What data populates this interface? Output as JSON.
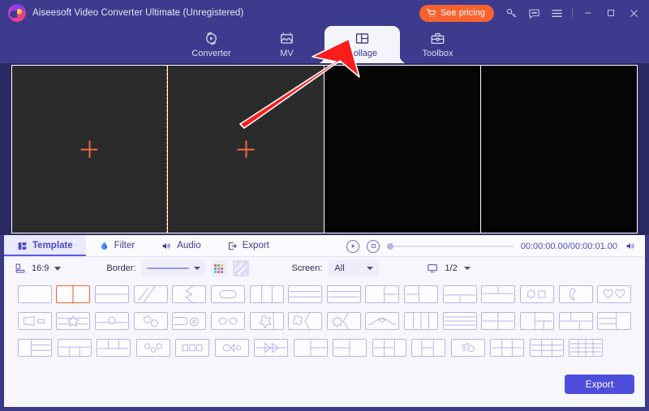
{
  "window": {
    "app_title": "Aiseesoft Video Converter Ultimate (Unregistered)",
    "logo_icon": "aiseesoft-logo-icon",
    "pricing_label": "See pricing",
    "pricing_icon": "shopping-cart-icon",
    "key_icon": "key-icon",
    "feedback_icon": "feedback-bubble-icon",
    "menu_icon": "hamburger-menu-icon",
    "minimize_icon": "minimize-icon",
    "maximize_icon": "maximize-icon",
    "close_icon": "close-icon",
    "accent_color": "#f8622f",
    "titlebar_color": "#3c3b8d"
  },
  "nav": {
    "tabs": [
      {
        "label": "Converter",
        "icon": "converter-icon",
        "active": false
      },
      {
        "label": "MV",
        "icon": "mv-picture-icon",
        "active": false
      },
      {
        "label": "Collage",
        "icon": "collage-layout-icon",
        "active": true
      },
      {
        "label": "Toolbox",
        "icon": "toolbox-icon",
        "active": false
      }
    ]
  },
  "preview": {
    "cells": [
      {
        "name": "collage-cell-1",
        "selected": true,
        "dark": false,
        "add_icon": "plus-add-media-icon"
      },
      {
        "name": "collage-cell-2",
        "selected": false,
        "dark": false,
        "add_icon": "plus-add-media-icon"
      },
      {
        "name": "collage-cell-3",
        "selected": false,
        "dark": true,
        "add_icon": ""
      },
      {
        "name": "collage-cell-4",
        "selected": false,
        "dark": true,
        "add_icon": ""
      }
    ]
  },
  "panel": {
    "tabs": [
      {
        "label": "Template",
        "icon": "template-layout-icon",
        "active": true
      },
      {
        "label": "Filter",
        "icon": "filter-droplet-icon",
        "active": false
      },
      {
        "label": "Audio",
        "icon": "audio-speaker-icon",
        "active": false
      },
      {
        "label": "Export",
        "icon": "export-arrow-icon",
        "active": false
      }
    ],
    "player": {
      "play_icon": "play-button-icon",
      "stop_icon": "stop-button-icon",
      "timecode": "00:00:00.00/00:00:01.00",
      "volume_icon": "volume-speaker-icon"
    },
    "settings": {
      "ratio_icon": "aspect-ratio-icon",
      "ratio_value": "16:9",
      "border_label": "Border:",
      "border_style_value": "solid-line",
      "border_color_icon": "color-palette-swatch-icon",
      "border_pattern_icon": "diagonal-stripes-swatch-icon",
      "screen_label": "Screen:",
      "screen_value": "All",
      "page_icon": "monitor-screen-icon",
      "page_value": "1/2"
    }
  },
  "templates": {
    "selected_index": 1,
    "rows": [
      [
        {
          "name": "template-single",
          "layout": "single"
        },
        {
          "name": "template-two-columns",
          "layout": "two-col"
        },
        {
          "name": "template-two-rows",
          "layout": "two-row"
        },
        {
          "name": "template-diagonal-split",
          "layout": "diagonal"
        },
        {
          "name": "template-arrow-cut",
          "layout": "arrow-cut"
        },
        {
          "name": "template-rounded-inset",
          "layout": "rounded-inset"
        },
        {
          "name": "template-three-columns",
          "layout": "three-col"
        },
        {
          "name": "template-three-rows",
          "layout": "three-row"
        },
        {
          "name": "template-three-rows-b",
          "layout": "three-row"
        },
        {
          "name": "template-left-big-right-split",
          "layout": "left-big-rsplit"
        },
        {
          "name": "template-left-split-right-big",
          "layout": "lsplit-right-big"
        },
        {
          "name": "template-top-wide-bottom-split",
          "layout": "top-wide-bsplit"
        },
        {
          "name": "template-top-split-bottom-wide",
          "layout": "tsplit-bottom-wide"
        },
        {
          "name": "template-hex-square",
          "layout": "hex-square"
        },
        {
          "name": "template-brush-shape",
          "layout": "brush"
        },
        {
          "name": "template-two-hearts",
          "layout": "hearts"
        }
      ],
      [
        {
          "name": "template-banner-small",
          "layout": "banner-small"
        },
        {
          "name": "template-star-band",
          "layout": "star-band"
        },
        {
          "name": "template-center-circle",
          "layout": "center-circle"
        },
        {
          "name": "template-two-circles",
          "layout": "two-circles"
        },
        {
          "name": "template-gear-shape",
          "layout": "gear"
        },
        {
          "name": "template-oval-pair",
          "layout": "oval-pair"
        },
        {
          "name": "template-star-cut",
          "layout": "star-cut"
        },
        {
          "name": "template-flower-cut",
          "layout": "flower-cut"
        },
        {
          "name": "template-burst-cut",
          "layout": "burst-cut"
        },
        {
          "name": "template-bow-shape",
          "layout": "bow"
        },
        {
          "name": "template-four-columns",
          "layout": "four-col"
        },
        {
          "name": "template-four-rows",
          "layout": "four-row"
        },
        {
          "name": "template-quad",
          "layout": "quad"
        },
        {
          "name": "template-left-big-three",
          "layout": "left-big-three"
        },
        {
          "name": "template-top-two-bottom-two",
          "layout": "t2b2"
        },
        {
          "name": "template-rows-right-big",
          "layout": "rows-right-big"
        }
      ],
      [
        {
          "name": "template-left-wide-right-rows",
          "layout": "lwide-rrows"
        },
        {
          "name": "template-top-wide-bottom-three",
          "layout": "twide-b3"
        },
        {
          "name": "template-top-three-bottom-wide",
          "layout": "t3-bwide"
        },
        {
          "name": "template-three-circles",
          "layout": "three-circles"
        },
        {
          "name": "template-three-squares",
          "layout": "three-squares"
        },
        {
          "name": "template-oval-arrow",
          "layout": "oval-arrow"
        },
        {
          "name": "template-double-arrow",
          "layout": "double-arrow"
        },
        {
          "name": "template-left-big-two-rows",
          "layout": "lbig-2rows"
        },
        {
          "name": "template-right-big-two-rows",
          "layout": "rbig-2rows"
        },
        {
          "name": "template-quad-right-wide",
          "layout": "quad-rwide"
        },
        {
          "name": "template-center-quad",
          "layout": "center-quad"
        },
        {
          "name": "template-dots-circle",
          "layout": "dots-circle"
        },
        {
          "name": "template-six-grid",
          "layout": "six-grid"
        },
        {
          "name": "template-six-grid-b",
          "layout": "six-grid"
        },
        {
          "name": "template-nine-grid",
          "layout": "nine-grid"
        }
      ]
    ]
  },
  "footer": {
    "export_label": "Export",
    "export_color": "#4f4ddb"
  },
  "annotation": {
    "arrow_color": "#fb1c1c",
    "arrow_name": "red-pointer-arrow"
  }
}
